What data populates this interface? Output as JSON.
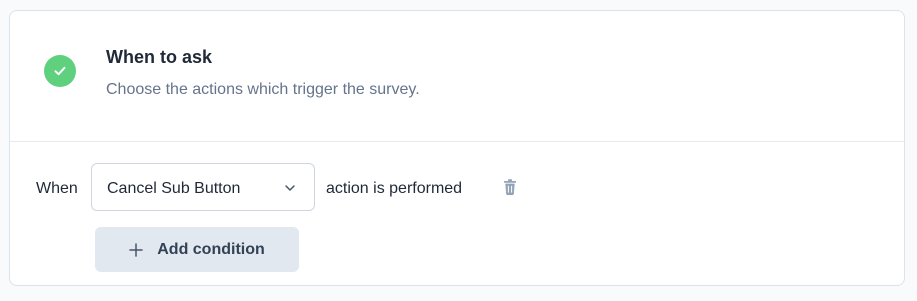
{
  "section": {
    "title": "When to ask",
    "subtitle": "Choose the actions which trigger the survey."
  },
  "condition": {
    "when_label": "When",
    "selected_action": "Cancel Sub Button",
    "suffix": "action is performed"
  },
  "add_condition_label": "Add condition",
  "colors": {
    "check": "#5fd07e",
    "button_bg": "#e2e8f0",
    "muted_text": "#64748b"
  },
  "icons": [
    "check-icon",
    "chevron-down-icon",
    "trash-icon",
    "plus-icon"
  ]
}
